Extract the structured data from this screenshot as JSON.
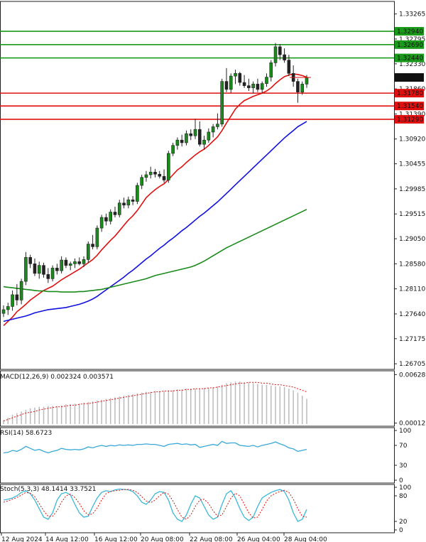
{
  "chart_data": {
    "type": "candlestick",
    "price_axis": {
      "range": [
        1.266,
        1.335
      ],
      "ticks": [
        "1.33265",
        "1.32795",
        "1.32330",
        "1.31860",
        "1.31390",
        "1.30920",
        "1.30455",
        "1.29985",
        "1.29515",
        "1.29050",
        "1.28580",
        "1.28110",
        "1.27640",
        "1.27175",
        "1.26705"
      ]
    },
    "current_price": {
      "value": 1.32074,
      "label": "1.32074"
    },
    "levels": [
      {
        "value": 1.3294,
        "label": "1.32940",
        "color": "#1a9a1a"
      },
      {
        "value": 1.3269,
        "label": "1.32690",
        "color": "#1a9a1a"
      },
      {
        "value": 1.3244,
        "label": "1.32440",
        "color": "#1a9a1a"
      },
      {
        "value": 1.3178,
        "label": "1.31780",
        "color": "#e01010"
      },
      {
        "value": 1.3154,
        "label": "1.31540",
        "color": "#e01010"
      },
      {
        "value": 1.3129,
        "label": "1.31290",
        "color": "#e01010"
      }
    ],
    "x_labels": [
      "12 Aug 2024",
      "14 Aug 12:00",
      "16 Aug 12:00",
      "20 Aug 08:00",
      "22 Aug 08:00",
      "26 Aug 04:00",
      "28 Aug 04:00"
    ],
    "candles": [
      {
        "o": 1.2765,
        "h": 1.278,
        "l": 1.2758,
        "c": 1.2772
      },
      {
        "o": 1.2772,
        "h": 1.2785,
        "l": 1.2762,
        "c": 1.2778
      },
      {
        "o": 1.2778,
        "h": 1.2808,
        "l": 1.277,
        "c": 1.28
      },
      {
        "o": 1.28,
        "h": 1.282,
        "l": 1.278,
        "c": 1.279
      },
      {
        "o": 1.279,
        "h": 1.283,
        "l": 1.2782,
        "c": 1.2825
      },
      {
        "o": 1.2825,
        "h": 1.288,
        "l": 1.2818,
        "c": 1.287
      },
      {
        "o": 1.287,
        "h": 1.2875,
        "l": 1.285,
        "c": 1.2858
      },
      {
        "o": 1.2858,
        "h": 1.2868,
        "l": 1.2835,
        "c": 1.284
      },
      {
        "o": 1.284,
        "h": 1.2862,
        "l": 1.283,
        "c": 1.2855
      },
      {
        "o": 1.2855,
        "h": 1.286,
        "l": 1.2832,
        "c": 1.2838
      },
      {
        "o": 1.2838,
        "h": 1.285,
        "l": 1.2822,
        "c": 1.283
      },
      {
        "o": 1.283,
        "h": 1.2855,
        "l": 1.2825,
        "c": 1.285
      },
      {
        "o": 1.285,
        "h": 1.2858,
        "l": 1.2838,
        "c": 1.2845
      },
      {
        "o": 1.2845,
        "h": 1.2872,
        "l": 1.284,
        "c": 1.2865
      },
      {
        "o": 1.2865,
        "h": 1.287,
        "l": 1.285,
        "c": 1.2855
      },
      {
        "o": 1.2855,
        "h": 1.2862,
        "l": 1.2846,
        "c": 1.2858
      },
      {
        "o": 1.2858,
        "h": 1.2868,
        "l": 1.285,
        "c": 1.2862
      },
      {
        "o": 1.2862,
        "h": 1.287,
        "l": 1.2855,
        "c": 1.2858
      },
      {
        "o": 1.2858,
        "h": 1.2872,
        "l": 1.2852,
        "c": 1.2866
      },
      {
        "o": 1.2866,
        "h": 1.29,
        "l": 1.286,
        "c": 1.2895
      },
      {
        "o": 1.2895,
        "h": 1.2912,
        "l": 1.2885,
        "c": 1.289
      },
      {
        "o": 1.289,
        "h": 1.293,
        "l": 1.2885,
        "c": 1.2925
      },
      {
        "o": 1.2925,
        "h": 1.295,
        "l": 1.2918,
        "c": 1.2945
      },
      {
        "o": 1.2945,
        "h": 1.2952,
        "l": 1.293,
        "c": 1.2938
      },
      {
        "o": 1.2938,
        "h": 1.296,
        "l": 1.2932,
        "c": 1.2955
      },
      {
        "o": 1.2955,
        "h": 1.2965,
        "l": 1.2945,
        "c": 1.295
      },
      {
        "o": 1.295,
        "h": 1.2978,
        "l": 1.2945,
        "c": 1.2972
      },
      {
        "o": 1.2972,
        "h": 1.2982,
        "l": 1.2962,
        "c": 1.2968
      },
      {
        "o": 1.2968,
        "h": 1.2984,
        "l": 1.2962,
        "c": 1.2978
      },
      {
        "o": 1.2978,
        "h": 1.2985,
        "l": 1.2968,
        "c": 1.2975
      },
      {
        "o": 1.2975,
        "h": 1.301,
        "l": 1.297,
        "c": 1.3005
      },
      {
        "o": 1.3005,
        "h": 1.3025,
        "l": 1.2998,
        "c": 1.302
      },
      {
        "o": 1.302,
        "h": 1.3032,
        "l": 1.3012,
        "c": 1.3025
      },
      {
        "o": 1.3025,
        "h": 1.304,
        "l": 1.3018,
        "c": 1.303
      },
      {
        "o": 1.303,
        "h": 1.3036,
        "l": 1.302,
        "c": 1.3026
      },
      {
        "o": 1.3026,
        "h": 1.3032,
        "l": 1.3018,
        "c": 1.3022
      },
      {
        "o": 1.3022,
        "h": 1.3035,
        "l": 1.301,
        "c": 1.3015
      },
      {
        "o": 1.3015,
        "h": 1.307,
        "l": 1.301,
        "c": 1.3065
      },
      {
        "o": 1.3065,
        "h": 1.3085,
        "l": 1.306,
        "c": 1.308
      },
      {
        "o": 1.308,
        "h": 1.3095,
        "l": 1.3072,
        "c": 1.309
      },
      {
        "o": 1.309,
        "h": 1.31,
        "l": 1.3078,
        "c": 1.3085
      },
      {
        "o": 1.3085,
        "h": 1.3108,
        "l": 1.308,
        "c": 1.3102
      },
      {
        "o": 1.3102,
        "h": 1.311,
        "l": 1.309,
        "c": 1.3098
      },
      {
        "o": 1.3098,
        "h": 1.313,
        "l": 1.3092,
        "c": 1.311
      },
      {
        "o": 1.311,
        "h": 1.3125,
        "l": 1.3078,
        "c": 1.3082
      },
      {
        "o": 1.3082,
        "h": 1.3098,
        "l": 1.3072,
        "c": 1.309
      },
      {
        "o": 1.309,
        "h": 1.3112,
        "l": 1.3085,
        "c": 1.3105
      },
      {
        "o": 1.3105,
        "h": 1.312,
        "l": 1.3095,
        "c": 1.3115
      },
      {
        "o": 1.3115,
        "h": 1.314,
        "l": 1.311,
        "c": 1.312
      },
      {
        "o": 1.312,
        "h": 1.3205,
        "l": 1.3115,
        "c": 1.32
      },
      {
        "o": 1.32,
        "h": 1.3225,
        "l": 1.318,
        "c": 1.3185
      },
      {
        "o": 1.3185,
        "h": 1.3215,
        "l": 1.3178,
        "c": 1.321
      },
      {
        "o": 1.321,
        "h": 1.3222,
        "l": 1.3195,
        "c": 1.3215
      },
      {
        "o": 1.3215,
        "h": 1.3218,
        "l": 1.3192,
        "c": 1.3198
      },
      {
        "o": 1.3198,
        "h": 1.3212,
        "l": 1.3188,
        "c": 1.3192
      },
      {
        "o": 1.3192,
        "h": 1.3205,
        "l": 1.3182,
        "c": 1.3188
      },
      {
        "o": 1.3188,
        "h": 1.32,
        "l": 1.3178,
        "c": 1.3195
      },
      {
        "o": 1.3195,
        "h": 1.3205,
        "l": 1.318,
        "c": 1.3185
      },
      {
        "o": 1.3185,
        "h": 1.32,
        "l": 1.3178,
        "c": 1.3196
      },
      {
        "o": 1.3196,
        "h": 1.3215,
        "l": 1.319,
        "c": 1.3208
      },
      {
        "o": 1.3208,
        "h": 1.324,
        "l": 1.32,
        "c": 1.3235
      },
      {
        "o": 1.3235,
        "h": 1.3272,
        "l": 1.3228,
        "c": 1.3265
      },
      {
        "o": 1.3265,
        "h": 1.327,
        "l": 1.324,
        "c": 1.325
      },
      {
        "o": 1.325,
        "h": 1.3262,
        "l": 1.3235,
        "c": 1.324
      },
      {
        "o": 1.324,
        "h": 1.325,
        "l": 1.321,
        "c": 1.3215
      },
      {
        "o": 1.3215,
        "h": 1.323,
        "l": 1.319,
        "c": 1.32
      },
      {
        "o": 1.32,
        "h": 1.3205,
        "l": 1.316,
        "c": 1.318
      },
      {
        "o": 1.318,
        "h": 1.32,
        "l": 1.3175,
        "c": 1.3195
      },
      {
        "o": 1.3195,
        "h": 1.3212,
        "l": 1.3188,
        "c": 1.3207
      }
    ],
    "moving_averages": [
      {
        "color": "#e01010",
        "values": [
          1.2742,
          1.275,
          1.2758,
          1.2768,
          1.2775,
          1.2782,
          1.279,
          1.2796,
          1.2802,
          1.2808,
          1.2812,
          1.2816,
          1.2822,
          1.2828,
          1.2833,
          1.2838,
          1.2843,
          1.2848,
          1.2854,
          1.286,
          1.2866,
          1.2874,
          1.2884,
          1.2893,
          1.2902,
          1.291,
          1.292,
          1.293,
          1.294,
          1.2948,
          1.2958,
          1.297,
          1.2982,
          1.299,
          1.2997,
          1.3003,
          1.3008,
          1.3016,
          1.3025,
          1.3034,
          1.304,
          1.3048,
          1.3055,
          1.3062,
          1.3068,
          1.3073,
          1.308,
          1.3088,
          1.3096,
          1.3108,
          1.3122,
          1.3135,
          1.3148,
          1.3157,
          1.3164,
          1.3168,
          1.3172,
          1.3175,
          1.3178,
          1.3182,
          1.3188,
          1.3196,
          1.3203,
          1.3209,
          1.3212,
          1.3214,
          1.3213,
          1.3211,
          1.3208
        ]
      },
      {
        "color": "#1010e0",
        "values": [
          1.275,
          1.2752,
          1.2754,
          1.2756,
          1.2758,
          1.276,
          1.2763,
          1.2766,
          1.2768,
          1.277,
          1.2772,
          1.2773,
          1.2774,
          1.2775,
          1.2776,
          1.2778,
          1.278,
          1.2782,
          1.2785,
          1.2788,
          1.2792,
          1.2797,
          1.2803,
          1.2809,
          1.2815,
          1.2821,
          1.2827,
          1.2833,
          1.284,
          1.2846,
          1.2853,
          1.286,
          1.2867,
          1.2873,
          1.288,
          1.2887,
          1.2893,
          1.29,
          1.2906,
          1.2913,
          1.292,
          1.2926,
          1.2933,
          1.294,
          1.2947,
          1.2953,
          1.296,
          1.2967,
          1.2974,
          1.2982,
          1.299,
          1.2998,
          1.3006,
          1.3014,
          1.3022,
          1.303,
          1.3038,
          1.3046,
          1.3054,
          1.3062,
          1.307,
          1.3078,
          1.3086,
          1.3094,
          1.3101,
          1.3108,
          1.3115,
          1.312,
          1.3125
        ]
      },
      {
        "color": "#1a8a1a",
        "values": [
          1.2815,
          1.2814,
          1.2813,
          1.2812,
          1.2811,
          1.281,
          1.2809,
          1.2808,
          1.2807,
          1.2807,
          1.2806,
          1.2806,
          1.2806,
          1.2805,
          1.2805,
          1.2805,
          1.2805,
          1.2806,
          1.2806,
          1.2807,
          1.2808,
          1.2809,
          1.281,
          1.2812,
          1.2814,
          1.2816,
          1.2818,
          1.282,
          1.2822,
          1.2824,
          1.2826,
          1.2828,
          1.283,
          1.2833,
          1.2836,
          1.2838,
          1.284,
          1.2842,
          1.2844,
          1.2846,
          1.2848,
          1.285,
          1.2852,
          1.2855,
          1.2859,
          1.2863,
          1.2868,
          1.2873,
          1.2878,
          1.2883,
          1.2888,
          1.2892,
          1.2896,
          1.29,
          1.2904,
          1.2908,
          1.2912,
          1.2916,
          1.292,
          1.2924,
          1.2928,
          1.2932,
          1.2936,
          1.294,
          1.2944,
          1.2948,
          1.2952,
          1.2956,
          1.296
        ]
      }
    ],
    "macd": {
      "label": "MACD(12,26,9) 0.002324 0.003571",
      "ticks": [
        "0.006289",
        "0.000122"
      ],
      "range": [
        0,
        0.0065
      ],
      "histogram": [
        0.0005,
        0.0008,
        0.0012,
        0.0014,
        0.0016,
        0.0018,
        0.002,
        0.0021,
        0.0022,
        0.0022,
        0.0023,
        0.0023,
        0.0023,
        0.0024,
        0.0025,
        0.0025,
        0.0026,
        0.0026,
        0.0027,
        0.0028,
        0.0029,
        0.003,
        0.0031,
        0.0032,
        0.0033,
        0.0034,
        0.0035,
        0.0036,
        0.0037,
        0.0038,
        0.0039,
        0.004,
        0.0041,
        0.0041,
        0.0042,
        0.0042,
        0.0042,
        0.0043,
        0.0043,
        0.0044,
        0.0044,
        0.0045,
        0.0045,
        0.0045,
        0.0045,
        0.0046,
        0.0046,
        0.0047,
        0.0048,
        0.005,
        0.0052,
        0.0053,
        0.0054,
        0.0054,
        0.0053,
        0.0053,
        0.0052,
        0.0051,
        0.005,
        0.005,
        0.0049,
        0.0048,
        0.0048,
        0.0047,
        0.0045,
        0.0043,
        0.004,
        0.0036,
        0.0032
      ],
      "signal": [
        0.0004,
        0.0006,
        0.0008,
        0.001,
        0.0012,
        0.0014,
        0.0015,
        0.0016,
        0.0018,
        0.0019,
        0.002,
        0.0021,
        0.0022,
        0.0022,
        0.0023,
        0.0024,
        0.0024,
        0.0025,
        0.0026,
        0.0026,
        0.0027,
        0.0028,
        0.0029,
        0.003,
        0.0031,
        0.0032,
        0.0033,
        0.0034,
        0.0035,
        0.0036,
        0.0037,
        0.0038,
        0.0039,
        0.004,
        0.0041,
        0.0041,
        0.0042,
        0.0042,
        0.0042,
        0.0043,
        0.0043,
        0.0044,
        0.0044,
        0.0045,
        0.0045,
        0.0045,
        0.0046,
        0.0046,
        0.0047,
        0.0048,
        0.0049,
        0.005,
        0.0051,
        0.0052,
        0.0052,
        0.0053,
        0.0053,
        0.0053,
        0.0052,
        0.0052,
        0.0051,
        0.005,
        0.005,
        0.0049,
        0.0048,
        0.0047,
        0.0045,
        0.0043,
        0.0041
      ]
    },
    "rsi": {
      "label": "RSI(14) 58.6723",
      "ticks": [
        100,
        70,
        30,
        0
      ],
      "range": [
        0,
        100
      ],
      "values": [
        55,
        56,
        60,
        58,
        62,
        68,
        64,
        60,
        62,
        58,
        55,
        58,
        60,
        64,
        62,
        61,
        62,
        61,
        63,
        67,
        65,
        68,
        70,
        68,
        70,
        69,
        71,
        70,
        71,
        70,
        72,
        72,
        73,
        72,
        72,
        70,
        68,
        72,
        73,
        74,
        72,
        73,
        71,
        72,
        66,
        68,
        70,
        72,
        70,
        78,
        74,
        75,
        75,
        70,
        69,
        68,
        70,
        67,
        70,
        72,
        74,
        77,
        73,
        70,
        65,
        63,
        58,
        60,
        62
      ]
    },
    "stoch": {
      "label": "Stoch(5,3,3) 48.1414 33.7521",
      "ticks": [
        100,
        80,
        20,
        0
      ],
      "range": [
        0,
        100
      ],
      "k": [
        70,
        72,
        75,
        80,
        88,
        92,
        85,
        70,
        50,
        30,
        25,
        40,
        70,
        85,
        88,
        82,
        60,
        40,
        30,
        32,
        55,
        75,
        88,
        92,
        90,
        94,
        96,
        95,
        94,
        90,
        80,
        65,
        60,
        70,
        85,
        90,
        88,
        70,
        40,
        25,
        20,
        35,
        60,
        80,
        75,
        55,
        35,
        25,
        30,
        60,
        85,
        92,
        75,
        50,
        30,
        22,
        30,
        55,
        75,
        82,
        88,
        92,
        95,
        90,
        70,
        40,
        20,
        25,
        48
      ],
      "d": [
        65,
        68,
        72,
        76,
        82,
        88,
        86,
        78,
        62,
        45,
        32,
        32,
        45,
        65,
        80,
        84,
        76,
        62,
        45,
        35,
        38,
        52,
        70,
        85,
        90,
        92,
        93,
        95,
        95,
        93,
        88,
        78,
        68,
        64,
        70,
        80,
        88,
        84,
        68,
        48,
        30,
        25,
        35,
        55,
        70,
        72,
        62,
        45,
        32,
        35,
        55,
        75,
        86,
        80,
        60,
        40,
        28,
        30,
        48,
        68,
        80,
        86,
        90,
        93,
        88,
        72,
        50,
        32,
        30
      ]
    }
  }
}
